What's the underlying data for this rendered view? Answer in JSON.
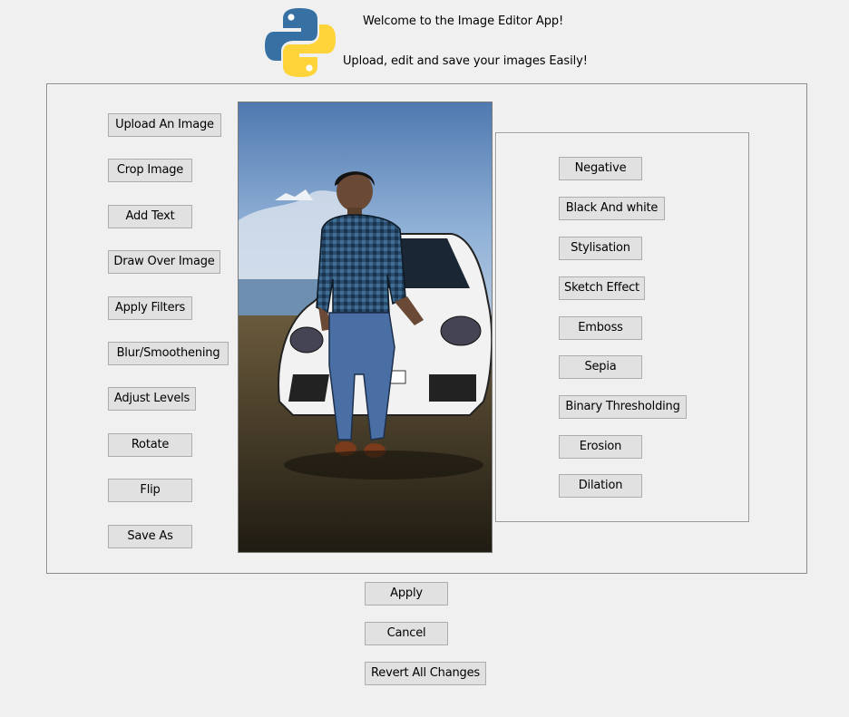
{
  "header": {
    "welcome": "Welcome to the Image Editor App!",
    "tagline": "Upload, edit and save your images Easily!"
  },
  "logo": {
    "icon": "python-logo-icon",
    "colors": {
      "blue": "#3771a4",
      "yellow": "#ffd43b"
    }
  },
  "left_menu": {
    "upload": "Upload An Image",
    "crop": "Crop Image",
    "add_text": "Add Text",
    "draw": "Draw Over Image",
    "filters": "Apply Filters",
    "blur": "Blur/Smoothening",
    "levels": "Adjust Levels",
    "rotate": "Rotate",
    "flip": "Flip",
    "save_as": "Save As"
  },
  "filters": {
    "negative": "Negative",
    "black_white": "Black And white",
    "stylisation": "Stylisation",
    "sketch": "Sketch Effect",
    "emboss": "Emboss",
    "sepia": "Sepia",
    "binary": "Binary Thresholding",
    "erosion": "Erosion",
    "dilation": "Dilation"
  },
  "actions": {
    "apply": "Apply",
    "cancel": "Cancel",
    "revert": "Revert All Changes"
  },
  "image_preview": {
    "subject": "man in blue checked shirt sitting on a white car",
    "colors": {
      "sky": "#6f93c2",
      "ground": "#3a3322",
      "car": "#f2f2f2",
      "shirt": "#2a4e6a",
      "jeans": "#4a6fa5"
    }
  }
}
